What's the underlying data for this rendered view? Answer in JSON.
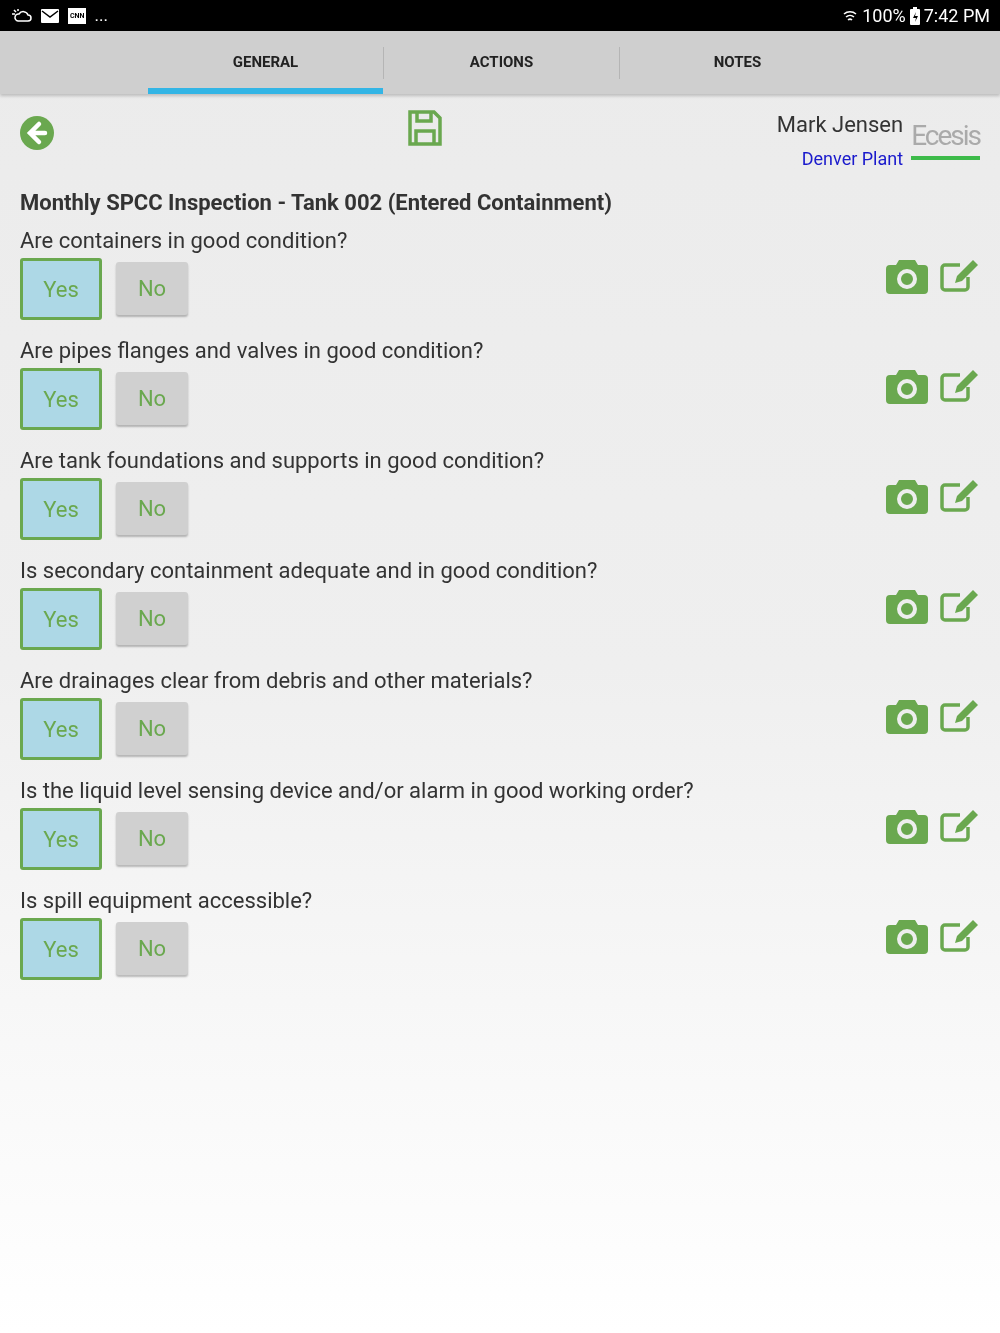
{
  "status_bar": {
    "notifications": [
      "CNN",
      "..."
    ],
    "battery": "100%",
    "time": "7:42 PM"
  },
  "tabs": [
    {
      "label": "GENERAL",
      "selected": true
    },
    {
      "label": "ACTIONS",
      "selected": false
    },
    {
      "label": "NOTES",
      "selected": false
    }
  ],
  "header": {
    "user": "Mark Jensen",
    "location": "Denver Plant",
    "logo": "Ecesis"
  },
  "form_title": "Monthly SPCC Inspection - Tank 002 (Entered Containment)",
  "questions": [
    {
      "text": "Are containers in good condition?",
      "options": [
        {
          "label": "Yes",
          "selected": true
        },
        {
          "label": "No",
          "selected": false
        }
      ]
    },
    {
      "text": "Are pipes flanges and valves in good condition?",
      "options": [
        {
          "label": "Yes",
          "selected": true
        },
        {
          "label": "No",
          "selected": false
        }
      ]
    },
    {
      "text": "Are tank foundations and supports in good condition?",
      "options": [
        {
          "label": "Yes",
          "selected": true
        },
        {
          "label": "No",
          "selected": false
        }
      ]
    },
    {
      "text": "Is secondary containment adequate and in good condition?",
      "options": [
        {
          "label": "Yes",
          "selected": true
        },
        {
          "label": "No",
          "selected": false
        }
      ]
    },
    {
      "text": "Are drainages clear from debris and other materials?",
      "options": [
        {
          "label": "Yes",
          "selected": true
        },
        {
          "label": "No",
          "selected": false
        }
      ]
    },
    {
      "text": "Is the liquid level sensing device and/or alarm in good working order?",
      "options": [
        {
          "label": "Yes",
          "selected": true
        },
        {
          "label": "No",
          "selected": false
        }
      ]
    },
    {
      "text": "Is spill equipment accessible?",
      "options": [
        {
          "label": "Yes",
          "selected": true
        },
        {
          "label": "No",
          "selected": false
        }
      ]
    }
  ]
}
